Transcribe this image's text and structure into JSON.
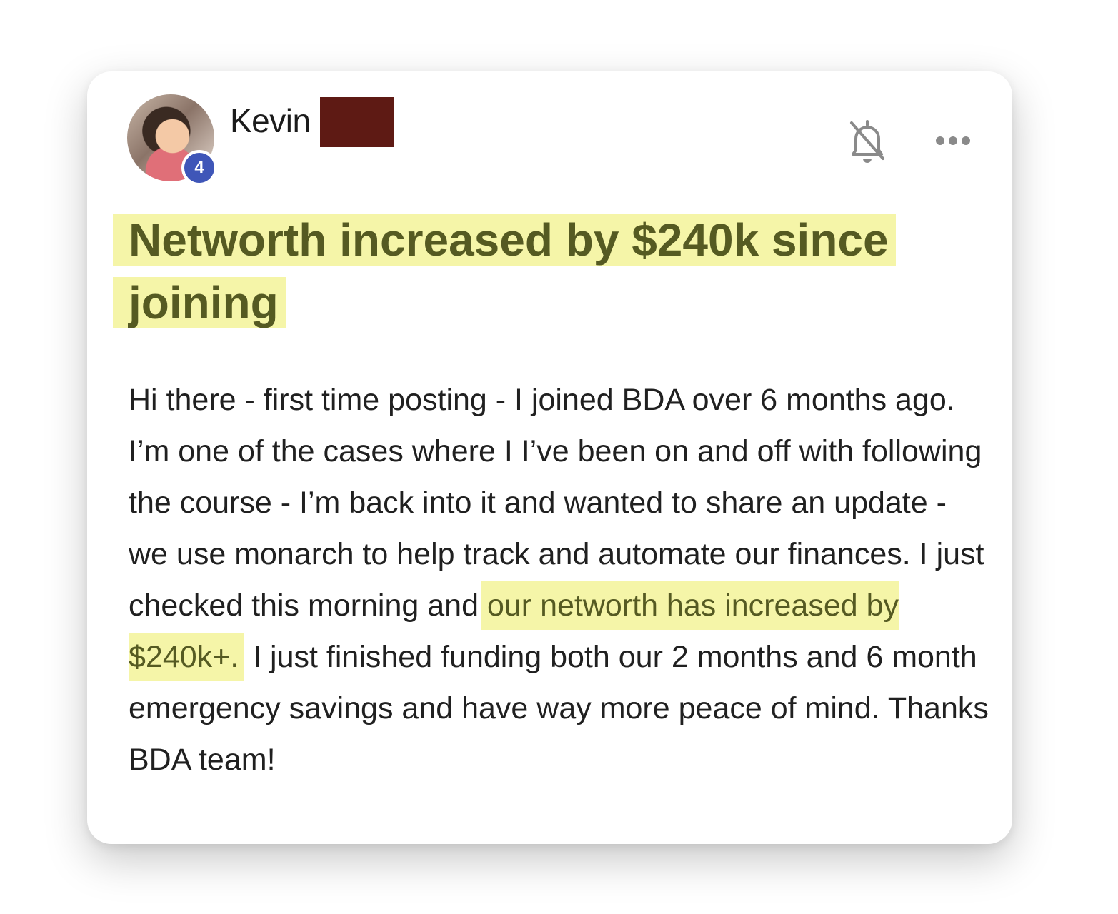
{
  "post": {
    "author_first_name": "Kevin",
    "author_level": "4",
    "title": "Networth increased by $240k since joining",
    "body_before_highlight": "Hi there - first time posting - I joined BDA over 6 months ago. I’m one of the cases where I I’ve been on and off with following the course - I’m back into it and wanted to share an update - we use monarch to help track and automate our finances. I just checked this morning and ",
    "body_highlight": "our networth has increased by $240k+.",
    "body_after_highlight": " I just finished funding both our 2 months and 6 month emergency savings and have way more peace of mind. Thanks BDA team!"
  },
  "icons": {
    "notification": "bell-off-icon",
    "menu": "more-horizontal-icon"
  },
  "colors": {
    "highlight_bg": "#f5f5a8",
    "highlight_text": "#555a22",
    "badge_bg": "#3f56b8",
    "redaction": "#5e1a14"
  }
}
